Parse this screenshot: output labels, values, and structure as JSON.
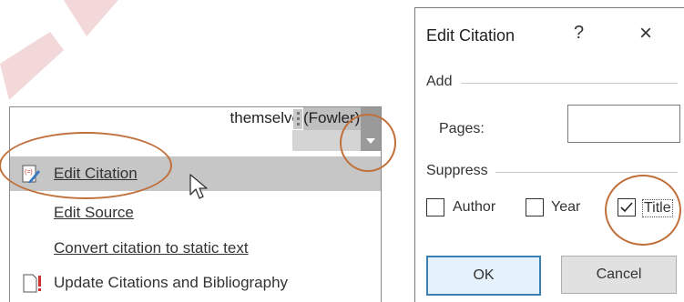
{
  "document": {
    "text": "themselve",
    "citation": "(Fowler)"
  },
  "context_menu": {
    "items": [
      {
        "label": "Edit Citation",
        "icon": "edit-citation-icon",
        "selected": true
      },
      {
        "label": "Edit Source",
        "icon": null,
        "selected": false
      },
      {
        "label": "Convert citation to static text",
        "icon": null,
        "selected": false
      },
      {
        "label": "Update Citations and Bibliography",
        "icon": "update-document-icon",
        "selected": false
      }
    ]
  },
  "dialog": {
    "title": "Edit Citation",
    "help_label": "?",
    "close_label": "×",
    "add_section": "Add",
    "pages_label": "Pages:",
    "pages_value": "",
    "suppress_section": "Suppress",
    "checkboxes": [
      {
        "label": "Author",
        "checked": false
      },
      {
        "label": "Year",
        "checked": false
      },
      {
        "label": "Title",
        "checked": true
      }
    ],
    "ok_label": "OK",
    "cancel_label": "Cancel"
  },
  "colors": {
    "highlight_circle": "#c0703a",
    "selected_item_bg": "#c6c6c6",
    "ok_border": "#3c7fb1"
  }
}
